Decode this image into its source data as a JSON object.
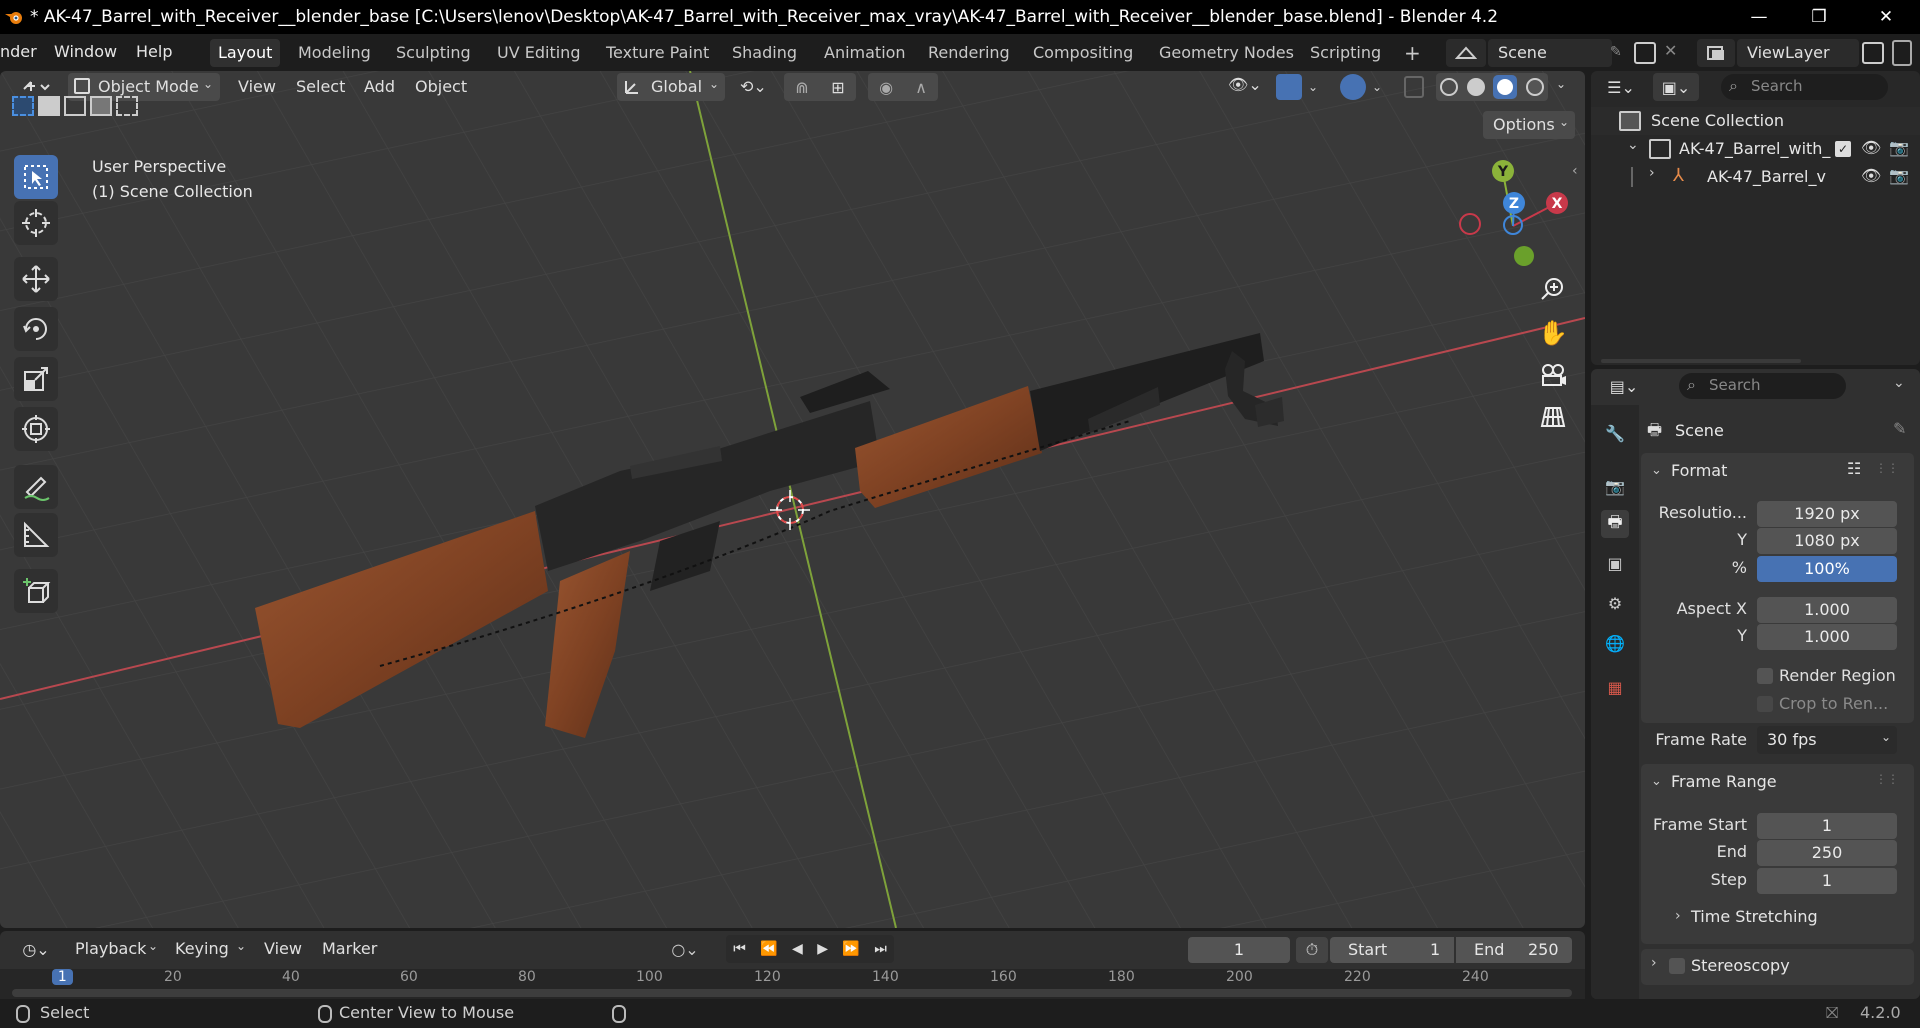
{
  "titlebar": {
    "title": "* AK-47_Barrel_with_Receiver__blender_base [C:\\Users\\lenov\\Desktop\\AK-47_Barrel_with_Receiver_max_vray\\AK-47_Barrel_with_Receiver__blender_base.blend] - Blender 4.2",
    "minimize": "—",
    "maximize": "❐",
    "close": "✕"
  },
  "menu": {
    "items": [
      "nder",
      "Window",
      "Help"
    ],
    "workspaces": [
      "Layout",
      "Modeling",
      "Sculpting",
      "UV Editing",
      "Texture Paint",
      "Shading",
      "Animation",
      "Rendering",
      "Compositing",
      "Geometry Nodes",
      "Scripting"
    ],
    "add_tab": "+",
    "scene": "Scene",
    "view_layer": "ViewLayer"
  },
  "viewport": {
    "mode": "Object Mode",
    "menus": [
      "View",
      "Select",
      "Add",
      "Object"
    ],
    "transform_orientation": "Global",
    "options": "Options",
    "overlay_line1": "User Perspective",
    "overlay_line2": "(1) Scene Collection",
    "gizmo": {
      "x": "X",
      "y": "Y",
      "z": "Z"
    },
    "colors": {
      "x_axis": "#c8394a",
      "y_axis": "#8bb33a",
      "z_axis": "#3f86d9",
      "stock": "#8a4a2a",
      "metal": "#262626"
    }
  },
  "outliner": {
    "search_placeholder": "Search",
    "root": "Scene Collection",
    "collection": "AK-47_Barrel_with_",
    "object": "AK-47_Barrel_v"
  },
  "properties": {
    "search_placeholder": "Search",
    "context": "Scene",
    "format_panel": "Format",
    "resolution_label": "Resolutio...",
    "res_x": "1920 px",
    "y_label": "Y",
    "res_y": "1080 px",
    "percent_label": "%",
    "percent": "100%",
    "aspect_x_label": "Aspect X",
    "aspect_x": "1.000",
    "aspect_y_label": "Y",
    "aspect_y": "1.000",
    "render_region": "Render Region",
    "crop": "Crop to Ren...",
    "frame_rate_label": "Frame Rate",
    "frame_rate": "30 fps",
    "frame_range_panel": "Frame Range",
    "frame_start_label": "Frame Start",
    "frame_start": "1",
    "end_label": "End",
    "end": "250",
    "step_label": "Step",
    "step": "1",
    "time_stretching": "Time Stretching",
    "stereoscopy": "Stereoscopy"
  },
  "timeline": {
    "menus": [
      "Playback",
      "Keying",
      "View",
      "Marker"
    ],
    "current_frame": "1",
    "start_label": "Start",
    "start": "1",
    "end_label": "End",
    "end": "250",
    "ruler": [
      "1",
      "20",
      "40",
      "60",
      "80",
      "100",
      "120",
      "140",
      "160",
      "180",
      "200",
      "220",
      "240"
    ]
  },
  "statusbar": {
    "select": "Select",
    "center": "Center View to Mouse",
    "version": "4.2.0"
  }
}
